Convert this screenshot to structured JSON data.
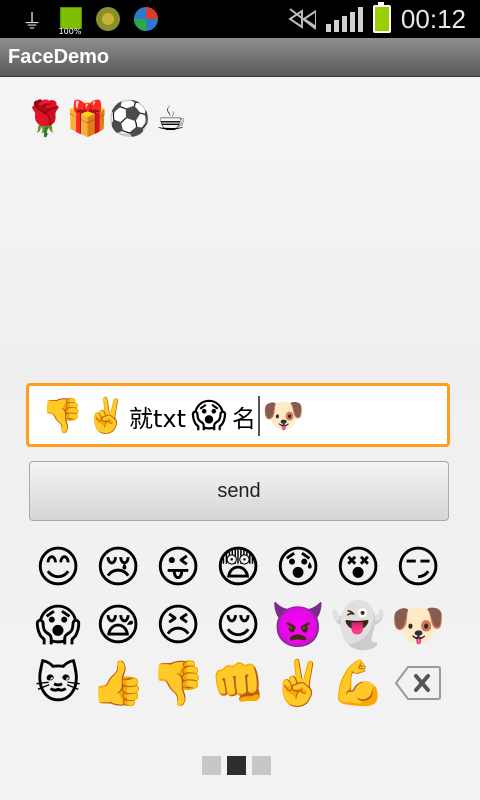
{
  "status_bar": {
    "battery_label": "100%",
    "time": "00:12",
    "icons": [
      "usb-icon",
      "battery-100-icon",
      "app-icon-1",
      "app-icon-2",
      "no-signal-icon",
      "signal-icon",
      "battery-icon"
    ]
  },
  "app": {
    "title": "FaceDemo"
  },
  "message": {
    "emojis": [
      "🌹",
      "🎁",
      "⚽",
      "☕"
    ]
  },
  "input": {
    "parts": [
      {
        "type": "emoji",
        "value": "👎"
      },
      {
        "type": "emoji",
        "value": "✌️"
      },
      {
        "type": "text",
        "value": "就txt"
      },
      {
        "type": "emoji",
        "value": "😱"
      },
      {
        "type": "text",
        "value": "名"
      },
      {
        "type": "emoji",
        "value": "🐶"
      }
    ]
  },
  "send_button": {
    "label": "send"
  },
  "emoji_grid": {
    "rows": [
      [
        "😊",
        "😢",
        "😜",
        "😨",
        "😰",
        "😵",
        "😏"
      ],
      [
        "😱",
        "😪",
        "😣",
        "😌",
        "👿",
        "👻",
        "🐶"
      ],
      [
        "🐱",
        "👍",
        "👎",
        "👊",
        "✌️",
        "💪",
        "⌫"
      ]
    ],
    "delete_icon": "backspace-icon"
  },
  "pager": {
    "pages": 3,
    "current": 2
  },
  "colors": {
    "input_focus": "#ff9d1f",
    "pager_active": "#2d2d2d",
    "pager_inactive": "#c7c7c7"
  }
}
